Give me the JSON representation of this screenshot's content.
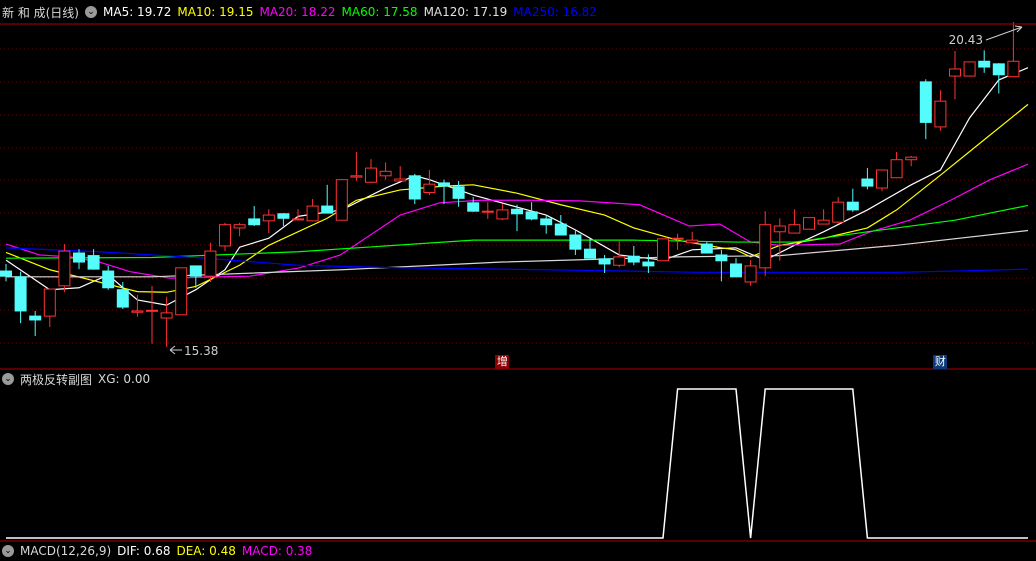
{
  "header": {
    "stock_name": "新 和 成(日线)",
    "ma": [
      {
        "label": "MA5: 19.72",
        "color": "#ffffff"
      },
      {
        "label": "MA10: 19.15",
        "color": "#ffff00"
      },
      {
        "label": "MA20: 18.22",
        "color": "#ff00ff"
      },
      {
        "label": "MA60: 17.58",
        "color": "#00ff00"
      },
      {
        "label": "MA120: 17.19",
        "color": "#e0e0e0"
      },
      {
        "label": "MA250: 16.82",
        "color": "#0000ff"
      }
    ]
  },
  "price_labels": {
    "high": "20.43",
    "low": "15.38"
  },
  "markers": [
    {
      "text": "增",
      "candle": 34,
      "color": "#8b0000"
    },
    {
      "text": "财",
      "candle": 64,
      "color": "#0a3a7a"
    }
  ],
  "indicator": {
    "title": "两极反转副图",
    "value_label": "XG: 0.00",
    "xg": [
      0,
      0,
      0,
      0,
      0,
      0,
      0,
      0,
      0,
      0,
      0,
      0,
      0,
      0,
      0,
      0,
      0,
      0,
      0,
      0,
      0,
      0,
      0,
      0,
      0,
      0,
      0,
      0,
      0,
      0,
      0,
      0,
      0,
      0,
      0,
      0,
      0,
      0,
      0,
      0,
      0,
      0,
      0,
      0,
      0,
      0,
      1,
      1,
      1,
      1,
      1,
      0,
      1,
      1,
      1,
      1,
      1,
      1,
      1,
      0,
      0,
      0,
      0,
      0,
      0,
      0,
      0,
      0,
      0,
      0,
      0
    ]
  },
  "macd": {
    "title": "MACD(12,26,9)",
    "dif": "DIF: 0.68",
    "dea": "DEA: 0.48",
    "macd": "MACD: 0.38"
  },
  "colors": {
    "up": "#ff3232",
    "down": "#54fcfc",
    "grid": "#7a0000",
    "separator": "#b00000"
  },
  "chart_data": {
    "type": "candlestick",
    "ohlc": [
      [
        16.56,
        16.67,
        16.4,
        16.48
      ],
      [
        16.47,
        16.55,
        15.75,
        15.94
      ],
      [
        15.86,
        15.94,
        15.55,
        15.8
      ],
      [
        15.86,
        16.28,
        15.69,
        16.28
      ],
      [
        16.33,
        16.98,
        16.23,
        16.87
      ],
      [
        16.84,
        16.9,
        16.59,
        16.7
      ],
      [
        16.8,
        16.9,
        16.58,
        16.59
      ],
      [
        16.56,
        16.64,
        16.27,
        16.3
      ],
      [
        16.27,
        16.39,
        15.97,
        16.0
      ],
      [
        15.92,
        16.19,
        15.85,
        15.94
      ],
      [
        15.95,
        16.33,
        15.43,
        15.95
      ],
      [
        15.83,
        16.16,
        15.38,
        15.91
      ],
      [
        15.88,
        16.61,
        15.88,
        16.61
      ],
      [
        16.64,
        16.64,
        16.3,
        16.48
      ],
      [
        16.48,
        17.0,
        16.39,
        16.87
      ],
      [
        16.95,
        17.31,
        16.87,
        17.28
      ],
      [
        17.23,
        17.31,
        17.1,
        17.28
      ],
      [
        17.37,
        17.57,
        17.26,
        17.28
      ],
      [
        17.34,
        17.52,
        17.15,
        17.43
      ],
      [
        17.45,
        17.46,
        17.26,
        17.38
      ],
      [
        17.37,
        17.52,
        17.35,
        17.37
      ],
      [
        17.34,
        17.68,
        17.34,
        17.57
      ],
      [
        17.57,
        17.9,
        17.46,
        17.46
      ],
      [
        17.35,
        17.98,
        17.35,
        17.98
      ],
      [
        18.02,
        18.41,
        17.96,
        18.04
      ],
      [
        17.94,
        18.3,
        17.93,
        18.16
      ],
      [
        18.04,
        18.25,
        17.98,
        18.11
      ],
      [
        17.96,
        18.19,
        17.96,
        17.99
      ],
      [
        18.04,
        18.07,
        17.6,
        17.68
      ],
      [
        17.78,
        18.13,
        17.74,
        17.91
      ],
      [
        17.93,
        17.98,
        17.6,
        17.88
      ],
      [
        17.87,
        17.96,
        17.56,
        17.69
      ],
      [
        17.62,
        17.71,
        17.48,
        17.49
      ],
      [
        17.49,
        17.63,
        17.37,
        17.49
      ],
      [
        17.37,
        17.6,
        17.35,
        17.51
      ],
      [
        17.52,
        17.59,
        17.18,
        17.45
      ],
      [
        17.48,
        17.63,
        17.35,
        17.37
      ],
      [
        17.37,
        17.43,
        17.14,
        17.28
      ],
      [
        17.29,
        17.43,
        17.12,
        17.12
      ],
      [
        17.12,
        17.2,
        16.81,
        16.9
      ],
      [
        16.9,
        17.06,
        16.76,
        16.76
      ],
      [
        16.75,
        16.81,
        16.53,
        16.67
      ],
      [
        16.65,
        17.03,
        16.62,
        16.78
      ],
      [
        16.79,
        16.95,
        16.65,
        16.7
      ],
      [
        16.7,
        16.82,
        16.53,
        16.64
      ],
      [
        16.72,
        17.06,
        16.72,
        17.06
      ],
      [
        17.07,
        17.14,
        16.89,
        17.07
      ],
      [
        17.0,
        17.17,
        17.0,
        17.04
      ],
      [
        16.98,
        17.01,
        16.84,
        16.84
      ],
      [
        16.81,
        16.89,
        16.4,
        16.72
      ],
      [
        16.67,
        16.76,
        16.47,
        16.47
      ],
      [
        16.39,
        16.73,
        16.33,
        16.64
      ],
      [
        16.61,
        17.49,
        16.48,
        17.28
      ],
      [
        17.17,
        17.38,
        16.72,
        17.26
      ],
      [
        17.15,
        17.52,
        17.15,
        17.28
      ],
      [
        17.21,
        17.38,
        17.21,
        17.39
      ],
      [
        17.29,
        17.52,
        17.29,
        17.35
      ],
      [
        17.32,
        17.71,
        17.29,
        17.63
      ],
      [
        17.63,
        17.84,
        17.48,
        17.51
      ],
      [
        17.99,
        18.16,
        17.83,
        17.88
      ],
      [
        17.85,
        18.13,
        17.8,
        18.13
      ],
      [
        18.01,
        18.41,
        18.01,
        18.29
      ],
      [
        18.29,
        18.35,
        18.19,
        18.33
      ],
      [
        19.5,
        19.54,
        18.61,
        18.87
      ],
      [
        18.8,
        19.37,
        18.74,
        19.2
      ],
      [
        19.59,
        19.98,
        19.23,
        19.7
      ],
      [
        19.59,
        19.81,
        19.59,
        19.81
      ],
      [
        19.82,
        19.99,
        19.64,
        19.73
      ],
      [
        19.78,
        19.79,
        19.32,
        19.61
      ],
      [
        19.58,
        20.43,
        19.58,
        19.82
      ]
    ],
    "ma_lines": [
      {
        "name": "MA5",
        "color": "#ffffff",
        "points": [
          [
            0,
            16.73
          ],
          [
            3,
            16.27
          ],
          [
            5,
            16.3
          ],
          [
            7,
            16.5
          ],
          [
            9,
            16.11
          ],
          [
            11,
            16.03
          ],
          [
            13,
            16.27
          ],
          [
            15,
            16.58
          ],
          [
            16,
            16.93
          ],
          [
            18,
            17.07
          ],
          [
            20,
            17.41
          ],
          [
            23,
            17.51
          ],
          [
            26,
            17.85
          ],
          [
            28,
            18.04
          ],
          [
            29,
            17.98
          ],
          [
            32,
            17.74
          ],
          [
            37,
            17.43
          ],
          [
            39,
            17.2
          ],
          [
            42,
            16.81
          ],
          [
            45,
            16.73
          ],
          [
            47,
            16.89
          ],
          [
            50,
            16.92
          ],
          [
            52,
            16.73
          ],
          [
            54,
            16.96
          ],
          [
            56,
            17.17
          ],
          [
            59,
            17.51
          ],
          [
            62,
            17.9
          ],
          [
            64,
            18.13
          ],
          [
            66,
            18.94
          ],
          [
            68,
            19.53
          ],
          [
            70,
            19.72
          ]
        ]
      },
      {
        "name": "MA10",
        "color": "#ffff00",
        "points": [
          [
            0,
            16.85
          ],
          [
            3,
            16.58
          ],
          [
            9,
            16.24
          ],
          [
            11,
            16.23
          ],
          [
            13,
            16.32
          ],
          [
            16,
            16.65
          ],
          [
            18,
            16.96
          ],
          [
            22,
            17.38
          ],
          [
            24,
            17.66
          ],
          [
            27,
            17.82
          ],
          [
            30,
            17.88
          ],
          [
            32,
            17.9
          ],
          [
            35,
            17.77
          ],
          [
            38,
            17.59
          ],
          [
            41,
            17.43
          ],
          [
            43,
            17.23
          ],
          [
            46,
            17.04
          ],
          [
            49,
            16.92
          ],
          [
            50,
            16.89
          ],
          [
            51,
            16.78
          ],
          [
            53,
            16.96
          ],
          [
            56,
            17.07
          ],
          [
            59,
            17.23
          ],
          [
            61,
            17.51
          ],
          [
            64,
            18.05
          ],
          [
            67,
            18.6
          ],
          [
            70,
            19.15
          ]
        ]
      },
      {
        "name": "MA20",
        "color": "#ff00ff",
        "points": [
          [
            0,
            16.98
          ],
          [
            2.3,
            16.81
          ],
          [
            4.4,
            16.78
          ],
          [
            6.4,
            16.7
          ],
          [
            8.5,
            16.55
          ],
          [
            11.2,
            16.45
          ],
          [
            14.7,
            16.47
          ],
          [
            16.7,
            16.48
          ],
          [
            20.1,
            16.61
          ],
          [
            22.9,
            16.81
          ],
          [
            27,
            17.43
          ],
          [
            29.7,
            17.62
          ],
          [
            32.5,
            17.66
          ],
          [
            35.9,
            17.66
          ],
          [
            39.3,
            17.65
          ],
          [
            43.4,
            17.59
          ],
          [
            46.8,
            17.26
          ],
          [
            48.9,
            17.29
          ],
          [
            51,
            17.01
          ],
          [
            53,
            16.96
          ],
          [
            57.1,
            16.98
          ],
          [
            59.2,
            17.17
          ],
          [
            61.9,
            17.35
          ],
          [
            64.7,
            17.66
          ],
          [
            67.4,
            17.98
          ],
          [
            70,
            18.22
          ]
        ]
      },
      {
        "name": "MA60",
        "color": "#00ff00",
        "points": [
          [
            0,
            16.76
          ],
          [
            10,
            16.77
          ],
          [
            20,
            16.86
          ],
          [
            32,
            17.04
          ],
          [
            43,
            17.04
          ],
          [
            50,
            17.01
          ],
          [
            54,
            17.01
          ],
          [
            59,
            17.17
          ],
          [
            65,
            17.35
          ],
          [
            70,
            17.58
          ]
        ]
      },
      {
        "name": "MA120",
        "color": "#d8d8d8",
        "points": [
          [
            0,
            16.47
          ],
          [
            10,
            16.47
          ],
          [
            23,
            16.58
          ],
          [
            34,
            16.7
          ],
          [
            46,
            16.78
          ],
          [
            53,
            16.8
          ],
          [
            61,
            16.96
          ],
          [
            70,
            17.19
          ]
        ]
      },
      {
        "name": "MA250",
        "color": "#0000ff",
        "points": [
          [
            0,
            16.92
          ],
          [
            6.4,
            16.86
          ],
          [
            13,
            16.77
          ],
          [
            20,
            16.65
          ],
          [
            27,
            16.61
          ],
          [
            37,
            16.58
          ],
          [
            47.5,
            16.54
          ],
          [
            61,
            16.54
          ],
          [
            65,
            16.56
          ],
          [
            70,
            16.59
          ]
        ]
      }
    ]
  }
}
